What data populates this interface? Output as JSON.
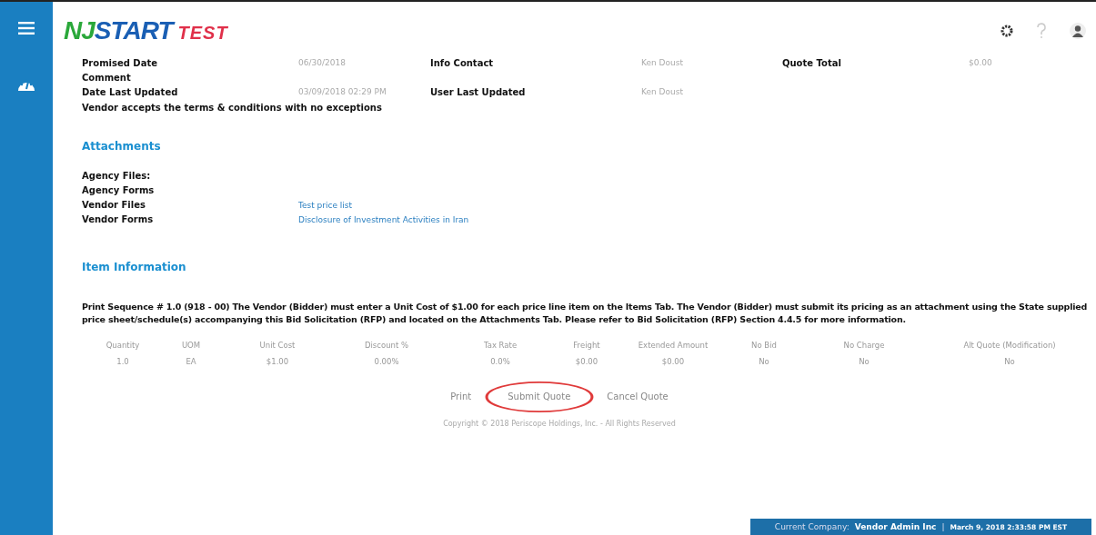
{
  "logo": {
    "brand_left": "NJ",
    "brand_right": "START",
    "overlay": "TEST"
  },
  "details": [
    [
      {
        "label": "Promised Date",
        "value": "06/30/2018"
      },
      {
        "label": "Info Contact",
        "value": "Ken Doust"
      },
      {
        "label": "Quote Total",
        "value": "$0.00"
      }
    ],
    [
      {
        "label": "Comment"
      }
    ],
    [
      {
        "label": "Date Last Updated",
        "value": "03/09/2018 02:29 PM"
      },
      {
        "label": "User Last Updated",
        "value": "Ken Doust"
      }
    ]
  ],
  "terms": "Vendor accepts the terms & conditions with no exceptions",
  "attachments": {
    "title": "Attachments",
    "rows": [
      {
        "label": "Agency Files:"
      },
      {
        "label": "Agency Forms"
      },
      {
        "label": "Vendor Files",
        "link": "Test price list"
      },
      {
        "label": "Vendor Forms",
        "link": "Disclosure of Investment Activities in Iran"
      }
    ]
  },
  "item_information": {
    "title": "Item Information",
    "description": "Print Sequence # 1.0   (918 - 00)  The Vendor (Bidder) must enter a Unit Cost of $1.00 for each price line item on the Items Tab. The Vendor (Bidder) must submit its pricing as an attachment using the State supplied price sheet/schedule(s) accompanying this Bid Solicitation (RFP) and located on the Attachments Tab. Please refer to Bid Solicitation (RFP) Section 4.4.5 for more information.",
    "table": {
      "columns": [
        "Quantity",
        "UOM",
        "Unit Cost",
        "Discount %",
        "Tax Rate",
        "Freight",
        "Extended Amount",
        "No Bid",
        "No Charge",
        "Alt Quote (Modification)"
      ],
      "rows": [
        [
          "1.0",
          "EA",
          "$1.00",
          "0.00%",
          "0.0%",
          "$0.00",
          "$0.00",
          "No",
          "No",
          "No"
        ]
      ]
    }
  },
  "actions": [
    {
      "label": "Print",
      "highlighted": false
    },
    {
      "label": "Submit Quote",
      "highlighted": true
    },
    {
      "label": "Cancel Quote",
      "highlighted": false
    }
  ],
  "copyright": "Copyright © 2018 Periscope Holdings, Inc. - All Rights Reserved",
  "status_bar": {
    "company_label": "Current Company:",
    "company": "Vendor Admin Inc",
    "separator": "|",
    "datetime": "March 9, 2018 2:33:58 PM EST"
  }
}
